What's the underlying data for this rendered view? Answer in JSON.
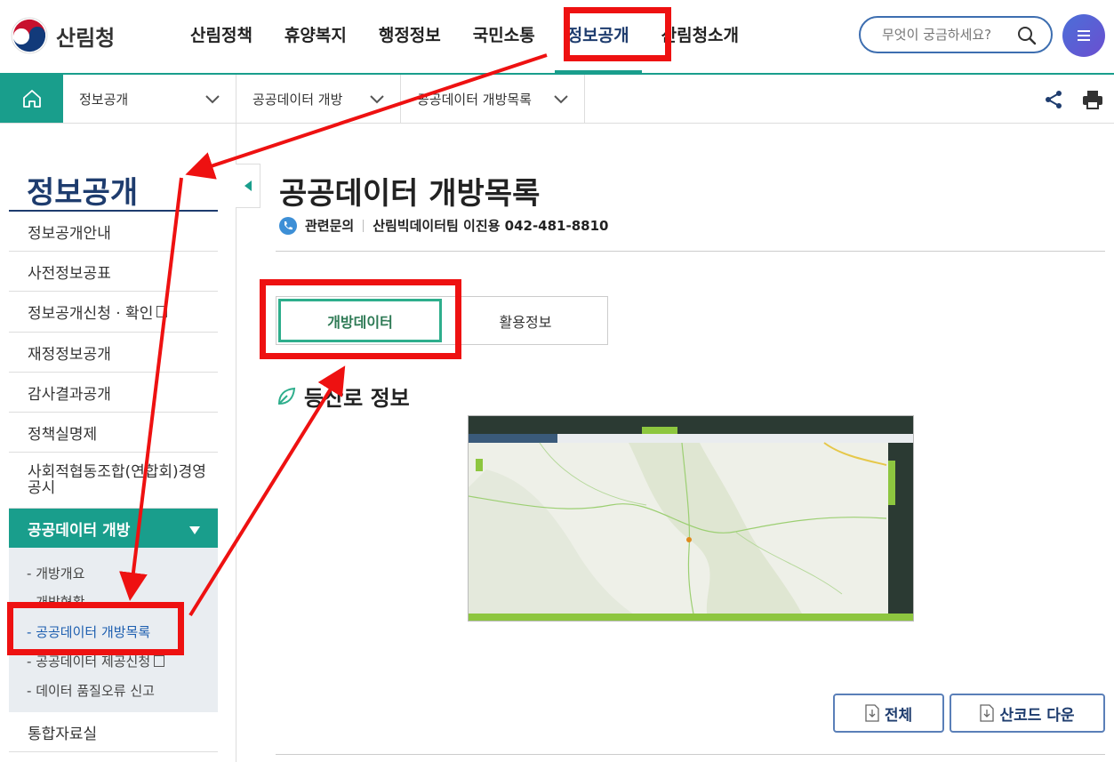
{
  "header": {
    "logo_text": "산림청",
    "nav": [
      "산림정책",
      "휴양복지",
      "행정정보",
      "국민소통",
      "정보공개",
      "산림청소개"
    ],
    "active_nav": "정보공개",
    "search_placeholder": "무엇이 궁금하세요?",
    "brand_color": "#199e8c",
    "navy_color": "#1e3c6e"
  },
  "location": {
    "crumbs": [
      "정보공개",
      "공공데이터 개방",
      "공공데이터 개방목록"
    ]
  },
  "sidebar": {
    "title": "정보공개",
    "items": [
      "정보공개안내",
      "사전정보공표",
      "정보공개신청 · 확인",
      "재정정보공개",
      "감사결과공개",
      "정책실명제",
      "사회적협동조합(연합회)경영공시",
      "공공데이터 개방",
      "통합자료실"
    ],
    "open_item": "공공데이터 개방",
    "sub_items": [
      "개방개요",
      "개방현황",
      "공공데이터 개방목록",
      "공공데이터 제공신청",
      "데이터 품질오류 신고"
    ],
    "current_sub": "공공데이터 개방목록"
  },
  "main": {
    "page_title": "공공데이터 개방목록",
    "contact_label": "관련문의",
    "contact_value": "산림빅데이터팀 이진용 042-481-8810",
    "tabs": [
      "개방데이터",
      "활용정보"
    ],
    "active_tab": "개방데이터",
    "section_title": "등산로 정보",
    "buttons": [
      "전체",
      "산코드 다운"
    ]
  },
  "annotation_color": "#ee1111"
}
